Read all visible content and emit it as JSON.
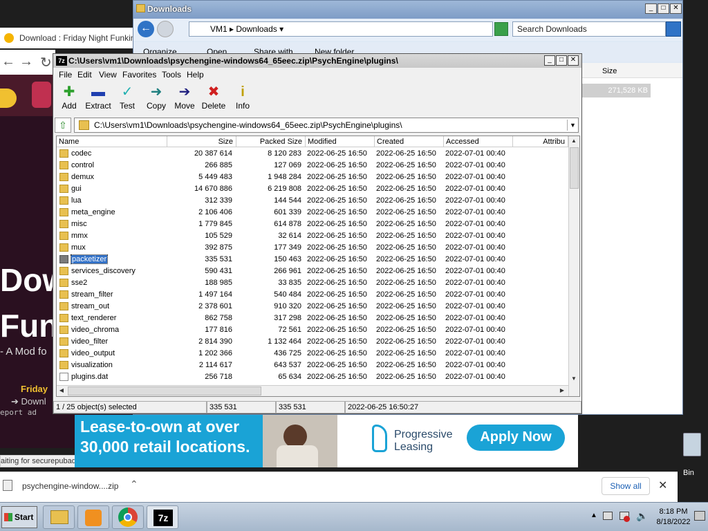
{
  "browser": {
    "tab_title": "Download : Friday Night Funkin' -",
    "page_big1": "Dow",
    "page_big2": "Fun",
    "page_sub": "- A Mod fo",
    "page_friday": "Friday",
    "page_down": "Downl",
    "page_report": "eport ad",
    "status": "aiting for securepubads.g.doubleclick.net...",
    "download_file": "psychengine-window....zip",
    "show_all": "Show all"
  },
  "ad": {
    "headline1": "Lease-to-own at over",
    "headline2": "30,000 retail locations.",
    "brand1": "Progressive",
    "brand2": "Leasing",
    "cta": "Apply Now"
  },
  "explorer": {
    "title": "Downloads",
    "breadcrumb": [
      "VM1",
      "Downloads"
    ],
    "search_placeholder": "Search Downloads",
    "toolbar": [
      "Organize",
      "Open",
      "Share with",
      "New folder"
    ],
    "col_size": "Size",
    "selected_size": "271,528 KB"
  },
  "sevenzip": {
    "title": "C:\\Users\\vm1\\Downloads\\psychengine-windows64_65eec.zip\\PsychEngine\\plugins\\",
    "menu": [
      "File",
      "Edit",
      "View",
      "Favorites",
      "Tools",
      "Help"
    ],
    "tools": [
      {
        "label": "Add",
        "icon": "add-icon",
        "color": "#2ea02e"
      },
      {
        "label": "Extract",
        "icon": "extract-icon",
        "color": "#2040b0"
      },
      {
        "label": "Test",
        "icon": "test-icon",
        "color": "#20b0b0"
      },
      {
        "label": "Copy",
        "icon": "copy-icon",
        "color": "#208080"
      },
      {
        "label": "Move",
        "icon": "move-icon",
        "color": "#202080"
      },
      {
        "label": "Delete",
        "icon": "delete-icon",
        "color": "#d02020"
      },
      {
        "label": "Info",
        "icon": "info-icon",
        "color": "#c0a000"
      }
    ],
    "path": "C:\\Users\\vm1\\Downloads\\psychengine-windows64_65eec.zip\\PsychEngine\\plugins\\",
    "columns": [
      "Name",
      "Size",
      "Packed Size",
      "Modified",
      "Created",
      "Accessed",
      "Attribu"
    ],
    "rows": [
      {
        "name": "codec",
        "size": "20 387 614",
        "packed": "8 120 283",
        "modified": "2022-06-25 16:50",
        "created": "2022-06-25 16:50",
        "accessed": "2022-07-01 00:40",
        "type": "folder"
      },
      {
        "name": "control",
        "size": "266 885",
        "packed": "127 069",
        "modified": "2022-06-25 16:50",
        "created": "2022-06-25 16:50",
        "accessed": "2022-07-01 00:40",
        "type": "folder"
      },
      {
        "name": "demux",
        "size": "5 449 483",
        "packed": "1 948 284",
        "modified": "2022-06-25 16:50",
        "created": "2022-06-25 16:50",
        "accessed": "2022-07-01 00:40",
        "type": "folder"
      },
      {
        "name": "gui",
        "size": "14 670 886",
        "packed": "6 219 808",
        "modified": "2022-06-25 16:50",
        "created": "2022-06-25 16:50",
        "accessed": "2022-07-01 00:40",
        "type": "folder"
      },
      {
        "name": "lua",
        "size": "312 339",
        "packed": "144 544",
        "modified": "2022-06-25 16:50",
        "created": "2022-06-25 16:50",
        "accessed": "2022-07-01 00:40",
        "type": "folder"
      },
      {
        "name": "meta_engine",
        "size": "2 106 406",
        "packed": "601 339",
        "modified": "2022-06-25 16:50",
        "created": "2022-06-25 16:50",
        "accessed": "2022-07-01 00:40",
        "type": "folder"
      },
      {
        "name": "misc",
        "size": "1 779 845",
        "packed": "614 878",
        "modified": "2022-06-25 16:50",
        "created": "2022-06-25 16:50",
        "accessed": "2022-07-01 00:40",
        "type": "folder"
      },
      {
        "name": "mmx",
        "size": "105 529",
        "packed": "32 614",
        "modified": "2022-06-25 16:50",
        "created": "2022-06-25 16:50",
        "accessed": "2022-07-01 00:40",
        "type": "folder"
      },
      {
        "name": "mux",
        "size": "392 875",
        "packed": "177 349",
        "modified": "2022-06-25 16:50",
        "created": "2022-06-25 16:50",
        "accessed": "2022-07-01 00:40",
        "type": "folder"
      },
      {
        "name": "packetizer",
        "size": "335 531",
        "packed": "150 463",
        "modified": "2022-06-25 16:50",
        "created": "2022-06-25 16:50",
        "accessed": "2022-07-01 00:40",
        "type": "gray",
        "selected": true
      },
      {
        "name": "services_discovery",
        "size": "590 431",
        "packed": "266 961",
        "modified": "2022-06-25 16:50",
        "created": "2022-06-25 16:50",
        "accessed": "2022-07-01 00:40",
        "type": "folder"
      },
      {
        "name": "sse2",
        "size": "188 985",
        "packed": "33 835",
        "modified": "2022-06-25 16:50",
        "created": "2022-06-25 16:50",
        "accessed": "2022-07-01 00:40",
        "type": "folder"
      },
      {
        "name": "stream_filter",
        "size": "1 497 164",
        "packed": "540 484",
        "modified": "2022-06-25 16:50",
        "created": "2022-06-25 16:50",
        "accessed": "2022-07-01 00:40",
        "type": "folder"
      },
      {
        "name": "stream_out",
        "size": "2 378 601",
        "packed": "910 320",
        "modified": "2022-06-25 16:50",
        "created": "2022-06-25 16:50",
        "accessed": "2022-07-01 00:40",
        "type": "folder"
      },
      {
        "name": "text_renderer",
        "size": "862 758",
        "packed": "317 298",
        "modified": "2022-06-25 16:50",
        "created": "2022-06-25 16:50",
        "accessed": "2022-07-01 00:40",
        "type": "folder"
      },
      {
        "name": "video_chroma",
        "size": "177 816",
        "packed": "72 561",
        "modified": "2022-06-25 16:50",
        "created": "2022-06-25 16:50",
        "accessed": "2022-07-01 00:40",
        "type": "folder"
      },
      {
        "name": "video_filter",
        "size": "2 814 390",
        "packed": "1 132 464",
        "modified": "2022-06-25 16:50",
        "created": "2022-06-25 16:50",
        "accessed": "2022-07-01 00:40",
        "type": "folder"
      },
      {
        "name": "video_output",
        "size": "1 202 366",
        "packed": "436 725",
        "modified": "2022-06-25 16:50",
        "created": "2022-06-25 16:50",
        "accessed": "2022-07-01 00:40",
        "type": "folder"
      },
      {
        "name": "visualization",
        "size": "2 114 617",
        "packed": "643 537",
        "modified": "2022-06-25 16:50",
        "created": "2022-06-25 16:50",
        "accessed": "2022-07-01 00:40",
        "type": "folder"
      },
      {
        "name": "plugins.dat",
        "size": "256 718",
        "packed": "65 634",
        "modified": "2022-06-25 16:50",
        "created": "2022-06-25 16:50",
        "accessed": "2022-07-01 00:40",
        "type": "file"
      }
    ],
    "status": {
      "selection": "1 / 25 object(s) selected",
      "size": "335 531",
      "packed": "335 531",
      "modified": "2022-06-25 16:50:27"
    }
  },
  "taskbar": {
    "start": "Start",
    "time": "8:18 PM",
    "date": "8/18/2022"
  },
  "desktop": {
    "bin_label": "Bin"
  }
}
